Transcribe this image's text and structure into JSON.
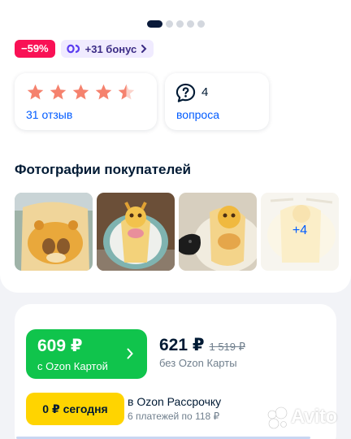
{
  "gallery": {
    "dots_total": 5,
    "active_dot": 1
  },
  "badges": {
    "discount": "−59%",
    "bonus": "+31 бонус"
  },
  "rating": {
    "stars": 4.5,
    "reviews_label": "31 отзыв"
  },
  "questions": {
    "count": "4",
    "label": "вопроса"
  },
  "customer_photos": {
    "title": "Фотографии покупателей",
    "more_label": "+4"
  },
  "pricing": {
    "ozon_card_price": "609 ₽",
    "ozon_card_label": "с Ozon Картой",
    "regular_price": "621 ₽",
    "old_price": "1 519 ₽",
    "regular_label": "без Ozon Карты"
  },
  "installment": {
    "button_label": "0 ₽ сегодня",
    "title": "в Ozon Рассрочку",
    "subtitle": "6 платежей по 118 ₽"
  },
  "watermark": {
    "text": "Avito"
  },
  "colors": {
    "discount": "#f91155",
    "ozon_card_green": "#10c44c",
    "installment_yellow": "#ffd400",
    "link_blue": "#005bff",
    "star": "#f5826e"
  }
}
